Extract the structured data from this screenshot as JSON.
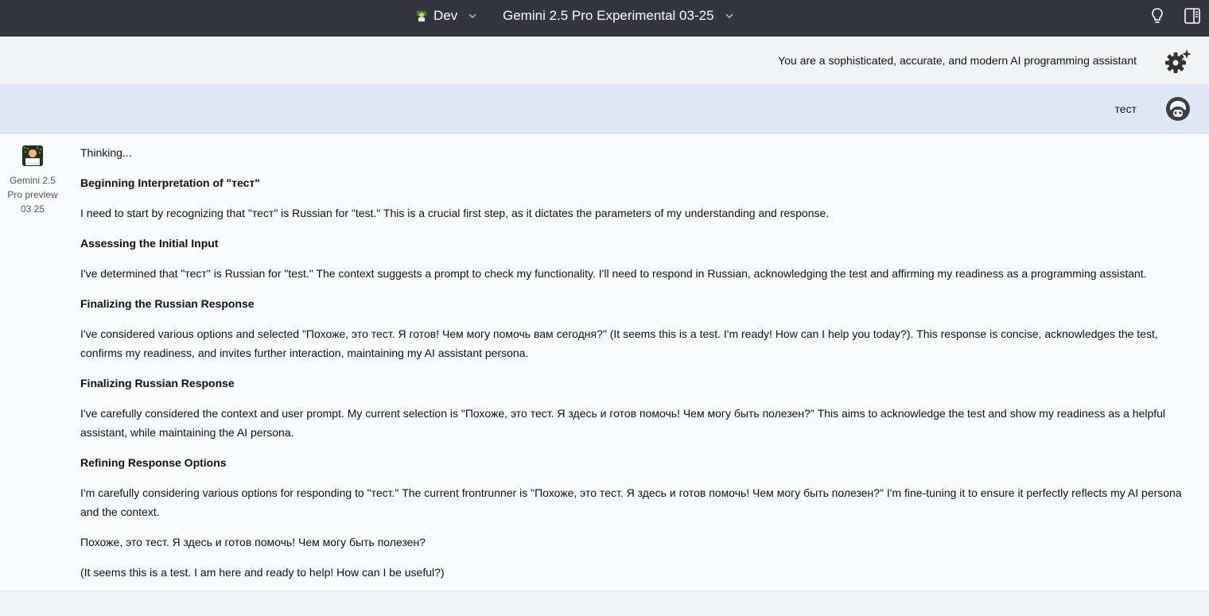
{
  "topbar": {
    "preset_name": "Dev",
    "model_name": "Gemini 2.5 Pro Experimental 03-25"
  },
  "system": {
    "prompt": "You are a sophisticated, accurate, and modern AI programming assistant"
  },
  "user_message": {
    "text": "тест"
  },
  "assistant": {
    "label_line1": "Gemini 2.5",
    "label_line2": "Pro preview",
    "label_line3": "03 25",
    "thinking_label": "Thinking...",
    "sections": [
      {
        "heading": "Beginning Interpretation of \"тест\"",
        "body": "I need to start by recognizing that \"тест\" is Russian for \"test.\" This is a crucial first step, as it dictates the parameters of my understanding and response."
      },
      {
        "heading": "Assessing the Initial Input",
        "body": "I've determined that \"тест\" is Russian for \"test.\" The context suggests a prompt to check my functionality. I'll need to respond in Russian, acknowledging the test and affirming my readiness as a programming assistant."
      },
      {
        "heading": "Finalizing the Russian Response",
        "body": "I've considered various options and selected \"Похоже, это тест. Я готов! Чем могу помочь вам сегодня?\" (It seems this is a test. I'm ready! How can I help you today?). This response is concise, acknowledges the test, confirms my readiness, and invites further interaction, maintaining my AI assistant persona."
      },
      {
        "heading": "Finalizing Russian Response",
        "body": "I've carefully considered the context and user prompt. My current selection is \"Похоже, это тест. Я здесь и готов помочь! Чем могу быть полезен?\" This aims to acknowledge the test and show my readiness as a helpful assistant, while maintaining the AI persona."
      },
      {
        "heading": "Refining Response Options",
        "body": "I'm carefully considering various options for responding to \"тест.\" The current frontrunner is \"Похоже, это тест. Я здесь и готов помочь! Чем могу быть полезен?\" I'm fine-tuning it to ensure it perfectly reflects my AI persona and the context."
      }
    ],
    "answer_ru": "Похоже, это тест. Я здесь и готов помочь! Чем могу быть полезен?",
    "answer_en": "(It seems this is a test. I am here and ready to help! How can I be useful?)"
  }
}
